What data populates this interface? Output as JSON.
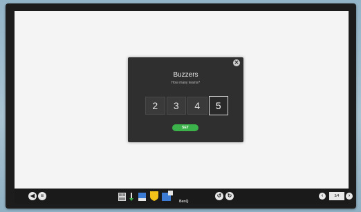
{
  "dialog": {
    "title": "Buzzers",
    "subtitle": "How many teams?",
    "options": [
      "2",
      "3",
      "4",
      "5"
    ],
    "selected": "5",
    "set_label": "SET",
    "close_icon": "close-icon"
  },
  "toolbar": {
    "brand": "BenQ",
    "page_indicator": "3/4",
    "left_icons": [
      "speaker-icon",
      "menu-icon"
    ],
    "center_icons": [
      "grid-icon",
      "pen-icon",
      "eraser-icon",
      "shield-icon",
      "screen-icon"
    ],
    "history_icons": [
      "undo-icon",
      "redo-icon"
    ],
    "nav_icons": [
      "prev-page-icon",
      "next-page-icon"
    ]
  },
  "colors": {
    "accent_green": "#3cb34a",
    "dialog_bg": "#2f2f2f",
    "toolbar_bg": "#1a1a1a",
    "canvas_bg": "#f4f4f4",
    "shield_yellow": "#f2c21b",
    "tool_blue": "#3b7bd4"
  }
}
